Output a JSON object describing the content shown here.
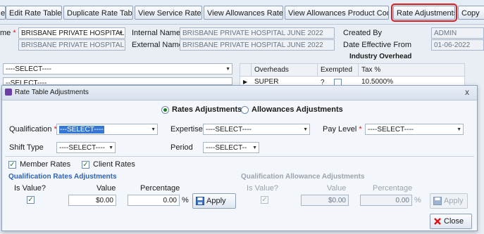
{
  "toolbar": {
    "buttons": [
      "e",
      "Edit Rate Table",
      "Duplicate Rate Table",
      "View Service Rates",
      "View Allowances Rates",
      "View Allowances Product Code",
      "Rate Adjustments",
      "Copy"
    ]
  },
  "form": {
    "name_label": "me",
    "name_value": "BRISBANE PRIVATE HOSPITAL",
    "name_value2": "BRISBANE PRIVATE HOSPITAL JU",
    "internal_label": "Internal Name",
    "internal_value": "BRISBANE PRIVATE HOSPITAL JUNE 2022",
    "external_label": "External Name",
    "external_value": "BRISBANE PRIVATE HOSPITAL JUNE 2022",
    "created_by_label": "Created By",
    "created_by_value": "ADMIN",
    "date_eff_label": "Date Effective From",
    "date_eff_value": "01-06-2022",
    "industry_overhead": "Industry Overhead",
    "select1": "----SELECT----",
    "select2": "--SELECT----"
  },
  "grid": {
    "headers": [
      "Overheads",
      "Exempted ?",
      "Tax %"
    ],
    "row1": [
      "SUPER",
      "",
      "10.5000%"
    ]
  },
  "dialog": {
    "title": "Rate Table Adjustments",
    "radio_rates": "Rates Adjustments",
    "radio_allowances": "Allowances Adjustments",
    "qualification_label": "Qualification",
    "qualification_value": "---SELECT----",
    "expertise_label": "Expertise",
    "expertise_value": "----SELECT----",
    "paylevel_label": "Pay Level",
    "paylevel_value": "----SELECT----",
    "shift_label": "Shift Type",
    "shift_value": "----SELECT----",
    "period_label": "Period",
    "period_value": "----SELECT--",
    "member_rates": "Member Rates",
    "client_rates": "Client Rates",
    "qual_rates_title": "Qualification Rates Adjustments",
    "qual_allow_title": "Qualification Allowance Adjustments",
    "is_value": "Is Value?",
    "value": "Value",
    "percentage": "Percentage",
    "value_amount": "$0.00",
    "pct_amount": "0.00",
    "pct_sign": "%",
    "apply": "Apply",
    "close": "Close",
    "close_x": "x"
  },
  "colors": {
    "accent": "#2d63b8",
    "highlight": "#e01b1b",
    "check": "#1a7c2a"
  }
}
